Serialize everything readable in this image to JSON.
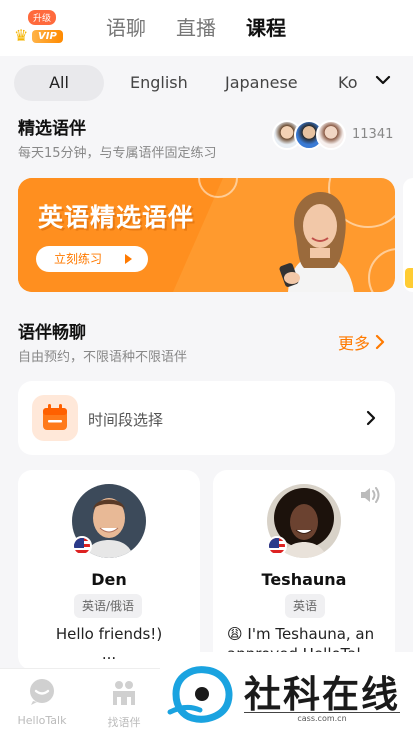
{
  "header": {
    "upgrade_label": "升级",
    "vip_label": "VIP",
    "tabs": [
      {
        "label": "语聊",
        "active": false
      },
      {
        "label": "直播",
        "active": false
      },
      {
        "label": "课程",
        "active": true
      }
    ]
  },
  "languages": {
    "chips": [
      "All",
      "English",
      "Japanese",
      "Ko"
    ],
    "selected": "All"
  },
  "featured": {
    "title": "精选语伴",
    "subtitle": "每天15分钟，与专属语伴固定练习",
    "count": "11341"
  },
  "banner": {
    "title": "英语精选语伴",
    "button_label": "立刻练习"
  },
  "chat_section": {
    "title": "语伴畅聊",
    "subtitle": "自由预约，不限语种不限语伴",
    "more_label": "更多"
  },
  "time_selector": {
    "label": "时间段选择"
  },
  "partners": [
    {
      "name": "Den",
      "languages": "英语/俄语",
      "bio": "Hello friends!)\n..."
    },
    {
      "name": "Teshauna",
      "languages": "英语",
      "bio": "😩 I'm Teshauna, an approved HelloTal..."
    }
  ],
  "bottom_nav": {
    "items": [
      {
        "label": "HelloTalk",
        "icon": "chat-bubble-icon"
      },
      {
        "label": "找语伴",
        "icon": "people-icon"
      }
    ]
  },
  "watermark": {
    "text": "社科在线",
    "url": "cass.com.cn"
  },
  "colors": {
    "accent": "#ff7a00",
    "banner": "#ff9a2e"
  }
}
